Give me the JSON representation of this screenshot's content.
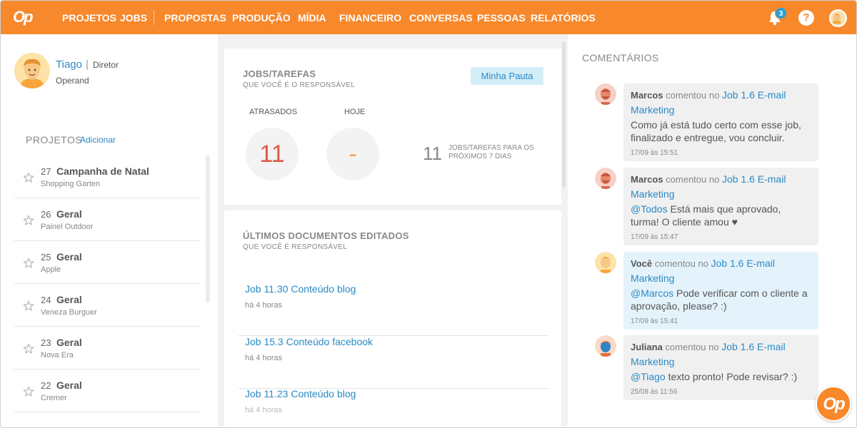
{
  "nav": {
    "logo": "Op",
    "items": [
      "PROJETOS",
      "JOBS",
      "PROPOSTAS",
      "PRODUÇÃO",
      "MÍDIA",
      "FINANCEIRO",
      "CONVERSAS",
      "PESSOAS",
      "RELATÓRIOS"
    ],
    "notifications": "3",
    "help": "?"
  },
  "profile": {
    "name": "Tiago",
    "role": "Diretor",
    "company": "Operand"
  },
  "projects": {
    "title": "PROJETOS",
    "add_label": "Adicionar",
    "items": [
      {
        "num": "27",
        "name": "Campanha de Natal",
        "client": "Shopping Garten"
      },
      {
        "num": "26",
        "name": "Geral",
        "client": "Painel Outdoor"
      },
      {
        "num": "25",
        "name": "Geral",
        "client": "Apple"
      },
      {
        "num": "24",
        "name": "Geral",
        "client": "Veneza Burguer"
      },
      {
        "num": "23",
        "name": "Geral",
        "client": "Nova Era"
      },
      {
        "num": "22",
        "name": "Geral",
        "client": "Cremer"
      }
    ]
  },
  "jobs_card": {
    "title": "JOBS/TAREFAS",
    "subtitle": "QUE VOCÊ É O RESPONSÁVEL",
    "button": "Minha Pauta",
    "late_label": "ATRASADOS",
    "late_value": "11",
    "today_label": "HOJE",
    "today_value": "-",
    "next_value": "11",
    "next_label": "JOBS/TAREFAS PARA OS PRÓXIMOS 7 DIAS"
  },
  "docs_card": {
    "title": "ÚLTIMOS DOCUMENTOS EDITADOS",
    "subtitle": "QUE VOCÊ É RESPONSÁVEL",
    "items": [
      {
        "title": "Job 11.30 Conteúdo blog",
        "date": "há 4 horas"
      },
      {
        "title": "Job 15.3 Conteúdo facebook",
        "date": "há 4 horas"
      },
      {
        "title": "Job 11.23 Conteúdo blog",
        "date": "há 4 horas"
      }
    ]
  },
  "comments": {
    "title": "COMENTÁRIOS",
    "items": [
      {
        "who": "Marcos",
        "verb": "comentou no",
        "job": "Job 1.6 E-mail Marketing",
        "mention": "",
        "text": "Como já está tudo certo com esse job, finalizado e entregue, vou concluir.",
        "time": "17/09 às 15:51"
      },
      {
        "who": "Marcos",
        "verb": "comentou no",
        "job": "Job 1.6 E-mail Marketing",
        "mention": "@Todos",
        "text": "Está mais que aprovado, turma! O cliente amou ♥",
        "time": "17/09 às 15:47"
      },
      {
        "who": "Você",
        "verb": "comentou no",
        "job": "Job 1.6 E-mail Marketing",
        "mention": "@Marcos",
        "text": "Pode verificar com o cliente a aprovação, please? :)",
        "time": "17/09 às 15:41"
      },
      {
        "who": "Juliana",
        "verb": "comentou no",
        "job": "Job 1.6 E-mail Marketing",
        "mention": "@Tiago",
        "text": "texto pronto! Pode revisar? :)",
        "time": "25/08 às 11:56"
      }
    ]
  },
  "fab": {
    "label": "Op"
  },
  "colors": {
    "brand": "#f7882b",
    "link": "#2a8ac6",
    "late": "#e05a4a",
    "today": "#f7a55f"
  }
}
